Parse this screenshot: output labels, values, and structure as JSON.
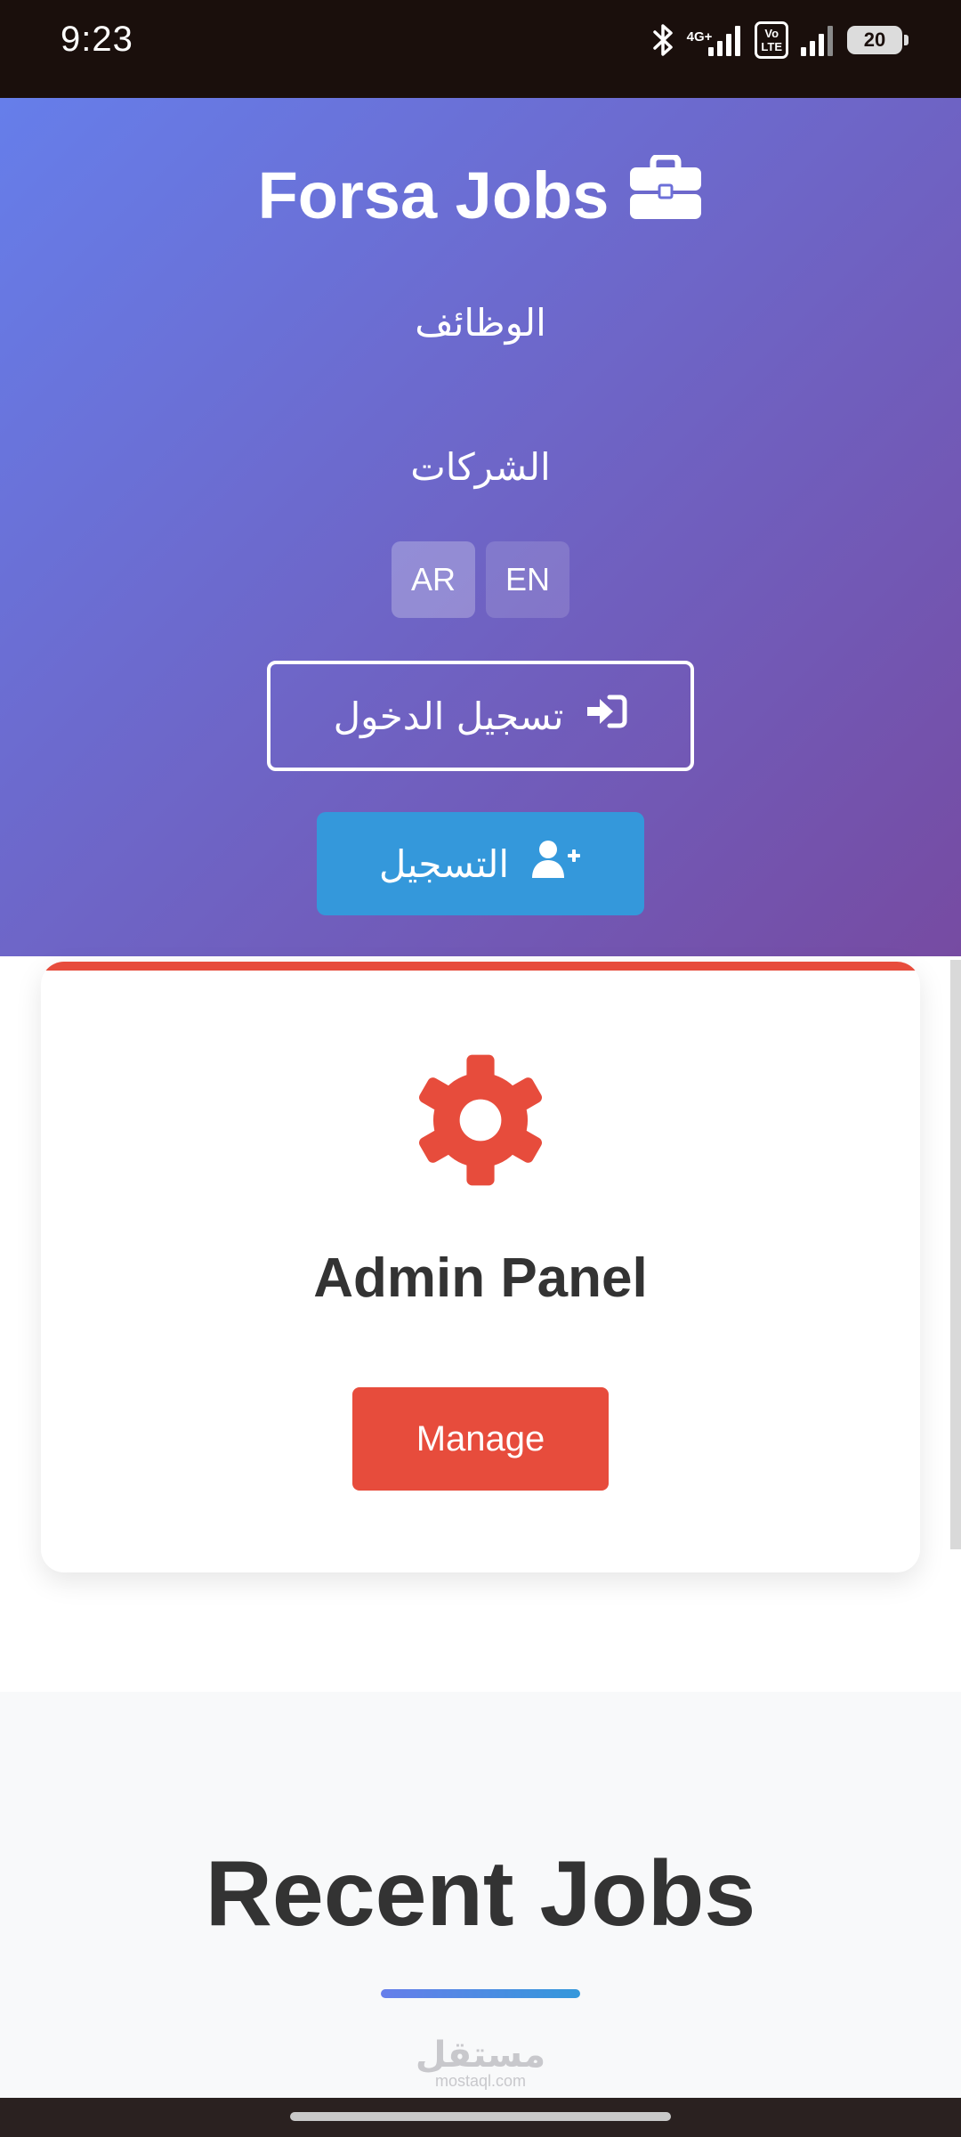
{
  "status_bar": {
    "time": "9:23",
    "network_label": "4G+",
    "volte_label_top": "Vo",
    "volte_label_bottom": "LTE",
    "battery": "20"
  },
  "header": {
    "brand": "Forsa Jobs",
    "brand_icon": "briefcase-icon",
    "nav": {
      "jobs": "الوظائف",
      "companies": "الشركات"
    },
    "languages": [
      "AR",
      "EN"
    ],
    "active_language": "AR",
    "login_label": "تسجيل الدخول",
    "login_icon": "sign-in-icon",
    "register_label": "التسجيل",
    "register_icon": "user-plus-icon"
  },
  "admin_card": {
    "icon": "gear-icon",
    "title": "Admin Panel",
    "button_label": "Manage"
  },
  "recent_jobs": {
    "title": "Recent Jobs"
  },
  "watermark": {
    "arabic": "مستقل",
    "latin": "mostaql.com"
  },
  "colors": {
    "gradient_start": "#667eea",
    "gradient_end": "#764ba2",
    "register_blue": "#3498db",
    "admin_red": "#e74c3c",
    "text_dark": "#333333"
  }
}
